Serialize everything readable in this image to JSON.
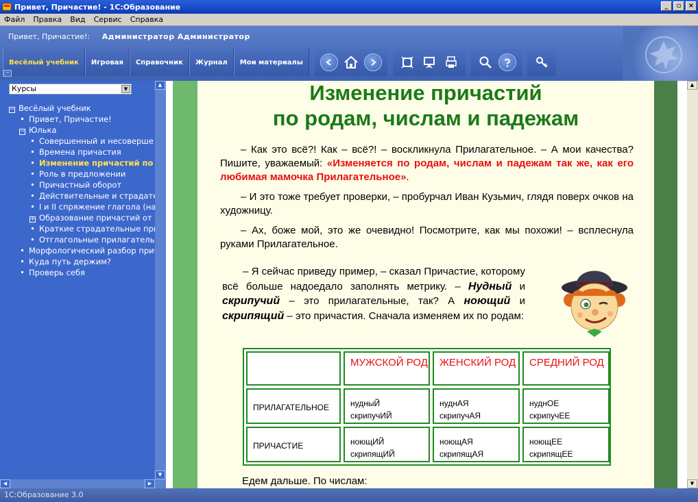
{
  "window": {
    "title": "Привет, Причастие! - 1С:Образование"
  },
  "menu": [
    "Файл",
    "Правка",
    "Вид",
    "Сервис",
    "Справка"
  ],
  "header": {
    "course": "Привет, Причастие!:",
    "user": "Администратор Администратор"
  },
  "nav_tabs": [
    "Весёлый учебник",
    "Игровая",
    "Справочник",
    "Журнал",
    "Мои материалы"
  ],
  "sidebar": {
    "combo_value": "Курсы",
    "tree": [
      {
        "label": "Весёлый учебник",
        "level": 0,
        "toggle": "⊟"
      },
      {
        "label": "Привет, Причастие!",
        "level": 1
      },
      {
        "label": "Юлька",
        "level": 1,
        "toggle": "⊟"
      },
      {
        "label": "Совершенный и несоверше",
        "level": 2
      },
      {
        "label": "Времена причастия",
        "level": 2
      },
      {
        "label": "Изменение причастий по",
        "level": 2,
        "selected": true
      },
      {
        "label": "Роль в предложении",
        "level": 2
      },
      {
        "label": "Причастный оборот",
        "level": 2
      },
      {
        "label": "Действительные и страдате",
        "level": 2
      },
      {
        "label": "I и II спряжение глагола (наг",
        "level": 2
      },
      {
        "label": "Образование причастий от г",
        "level": 2,
        "toggle": "⊞"
      },
      {
        "label": "Краткие страдательные прич",
        "level": 2
      },
      {
        "label": "Отглагольные прилагательн",
        "level": 2
      },
      {
        "label": "Морфологический разбор прич",
        "level": 1
      },
      {
        "label": "Куда путь держим?",
        "level": 1
      },
      {
        "label": "Проверь себя",
        "level": 1
      }
    ]
  },
  "lesson": {
    "title_line1": "Изменение причастий",
    "title_line2": "по родам, числам и падежам",
    "p1_start": "– Как это всё?! Как – всё?! – воскликнула Прилагательное. – А мои качества? Пишите, уважаемый: ",
    "p1_red": "«Изменяется по родам, числам и падежам так же, как его любимая мамочка Прилагательное»",
    "p1_end": ".",
    "p2": "– И это тоже требует проверки, – пробурчал Иван Кузьмич, глядя поверх очков на художницу.",
    "p3": "– Ах, боже мой, это же очевидно! Посмотрите, как мы похожи! – всплеснула руками Прилагательное.",
    "p4_a": "– Я сейчас приведу пример, – сказал Причастие, которому всё больше надоедало заполнять метрику. – ",
    "p4_w1": "Нудный",
    "p4_and1": " и ",
    "p4_w2": "скрипучий",
    "p4_b": " – это прилагательные, так? А ",
    "p4_w3": "ноющий",
    "p4_and2": " и ",
    "p4_w4": "скрипящий",
    "p4_c": " – это причастия. Сначала изменяем их по родам:",
    "table": {
      "headers": [
        "МУЖСКОЙ РОД",
        "ЖЕНСКИЙ РОД",
        "СРЕДНИЙ РОД"
      ],
      "rows": [
        {
          "label": "ПРИЛАГАТЕЛЬНОЕ",
          "cells": [
            [
              "нудныЙ",
              "скрипучИЙ"
            ],
            [
              "нуднАЯ",
              "скрипучАЯ"
            ],
            [
              "нуднОЕ",
              "скрипучЕЕ"
            ]
          ]
        },
        {
          "label": "ПРИЧАСТИЕ",
          "cells": [
            [
              "ноющИЙ",
              "скрипящИЙ"
            ],
            [
              "ноющАЯ",
              "скрипящАЯ"
            ],
            [
              "ноющЕЕ",
              "скрипящЕЕ"
            ]
          ]
        }
      ]
    },
    "next": "Едем дальше. По числам:"
  },
  "status": "1С:Образование 3.0",
  "colors": {
    "title_green": "#1b7a18",
    "accent_red": "#e81010",
    "panel_blue": "#3c68cb"
  }
}
